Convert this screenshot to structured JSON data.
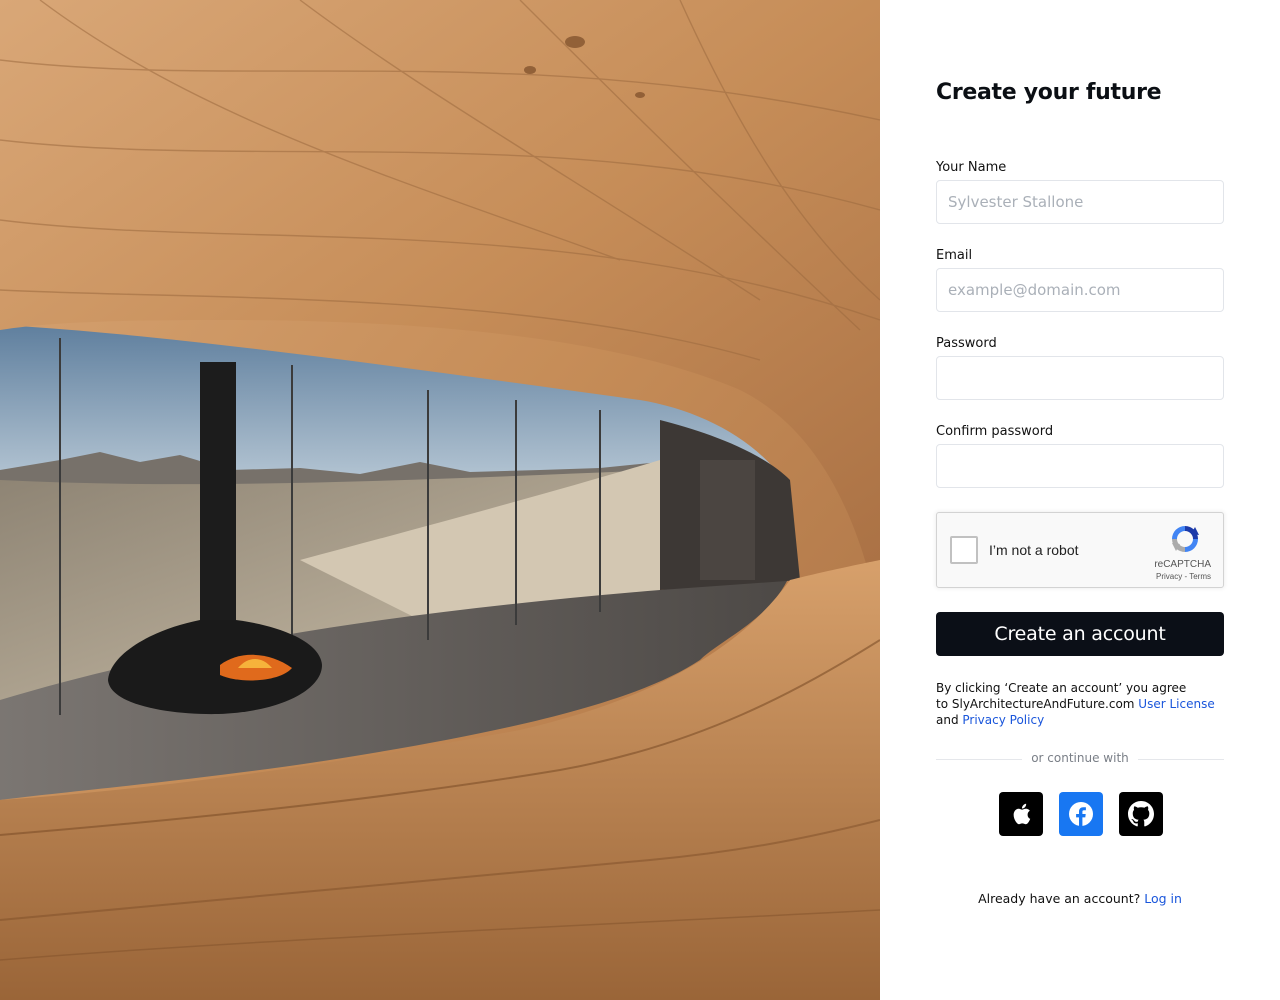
{
  "hero": {
    "image_description_icon": "photo-icon",
    "colors": {
      "wood": "#c9915d",
      "wood_dark": "#8a5a33",
      "sky": "#9fb4c8",
      "floor": "#5e5a57"
    }
  },
  "form": {
    "title": "Create your future",
    "name": {
      "label": "Your Name",
      "placeholder": "Sylvester Stallone",
      "value": ""
    },
    "email": {
      "label": "Email",
      "placeholder": "example@domain.com",
      "value": ""
    },
    "password": {
      "label": "Password",
      "placeholder": "",
      "value": ""
    },
    "confirm_password": {
      "label": "Confirm password",
      "placeholder": "",
      "value": ""
    },
    "captcha": {
      "label": "I’m not a robot",
      "brand": "reCAPTCHA",
      "privacy": "Privacy",
      "separator": " - ",
      "terms": "Terms",
      "checked": false
    },
    "submit_label": "Create an account",
    "terms_text": {
      "line1": "By clicking ‘Create an account’ you agree",
      "line2_prefix": "to SlyArchitectureAndFuture.com ",
      "user_license": "User License",
      "line3_prefix": "and ",
      "privacy_policy": "Privacy Policy"
    },
    "divider_text": "or continue with",
    "social": [
      {
        "name": "apple-icon",
        "color": "#000000"
      },
      {
        "name": "facebook-icon",
        "color": "#1877f2"
      },
      {
        "name": "github-icon",
        "color": "#000000"
      }
    ],
    "login_prompt": "Already have an account?",
    "login_link": "Log in"
  },
  "colors": {
    "primary": "#0b0f17",
    "link": "#1a56db",
    "input_border": "#e2e5ea"
  }
}
